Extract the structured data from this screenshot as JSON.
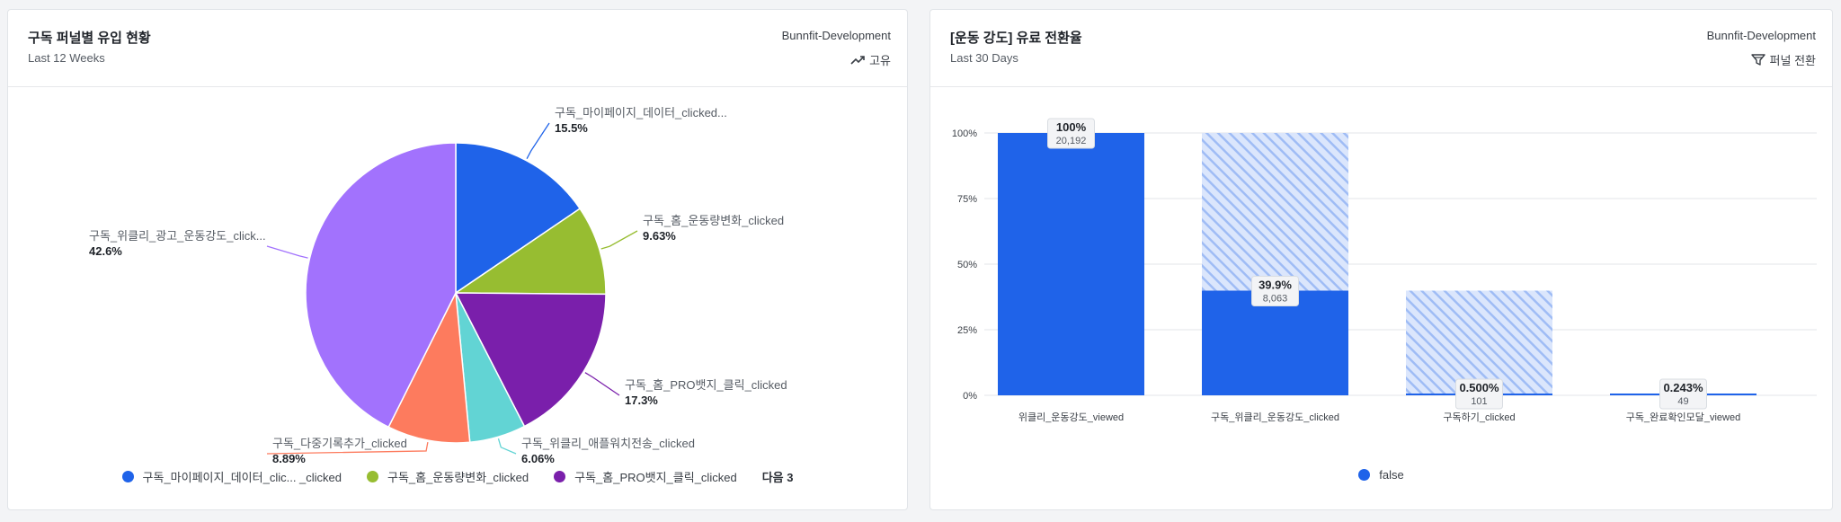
{
  "left": {
    "title": "구독 퍼널별 유입 현황",
    "subtitle": "Last 12 Weeks",
    "workspace": "Bunnfit-Development",
    "metric_label": "고유",
    "legend_more": "다음 3"
  },
  "right": {
    "title": "[운동 강도] 유료 전환율",
    "subtitle": "Last 30 Days",
    "workspace": "Bunnfit-Development",
    "metric_label": "퍼널 전환"
  },
  "chart_data": [
    {
      "type": "pie",
      "slices": [
        {
          "label": "구독_마이페이지_데이터_clicked...",
          "legend": "구독_마이페이지_데이터_clic... _clicked",
          "value": 15.5,
          "pct_label": "15.5%",
          "color": "#1f63e9"
        },
        {
          "label": "구독_홈_운동량변화_clicked",
          "legend": "구독_홈_운동량변화_clicked",
          "value": 9.63,
          "pct_label": "9.63%",
          "color": "#97bd31"
        },
        {
          "label": "구독_홈_PRO뱃지_클릭_clicked",
          "legend": "구독_홈_PRO뱃지_클릭_clicked",
          "value": 17.3,
          "pct_label": "17.3%",
          "color": "#7a1fab"
        },
        {
          "label": "구독_위클리_애플워치전송_clicked",
          "value": 6.06,
          "pct_label": "6.06%",
          "color": "#62d4d4"
        },
        {
          "label": "구독_다중기록추가_clicked",
          "value": 8.89,
          "pct_label": "8.89%",
          "color": "#fd7b5e"
        },
        {
          "label": "구독_위클리_광고_운동강도_click...",
          "value": 42.6,
          "pct_label": "42.6%",
          "color": "#a272fd"
        }
      ]
    },
    {
      "type": "bar",
      "subtype": "funnel",
      "categories": [
        "위클리_운동강도_viewed",
        "구독_위클리_운동강도_clicked",
        "구독하기_clicked",
        "구독_완료확인모달_viewed"
      ],
      "series": [
        {
          "name": "false",
          "values": [
            100,
            39.9,
            0.5,
            0.243
          ]
        }
      ],
      "value_labels": [
        "100%",
        "39.9%",
        "0.500%",
        "0.243%"
      ],
      "counts": [
        "20,192",
        "8,063",
        "101",
        "49"
      ],
      "yticks": [
        "0%",
        "25%",
        "50%",
        "75%",
        "100%"
      ],
      "ylim": [
        0,
        100
      ],
      "color": "#1f63e9",
      "grid": true,
      "legend_position": "bottom"
    }
  ]
}
